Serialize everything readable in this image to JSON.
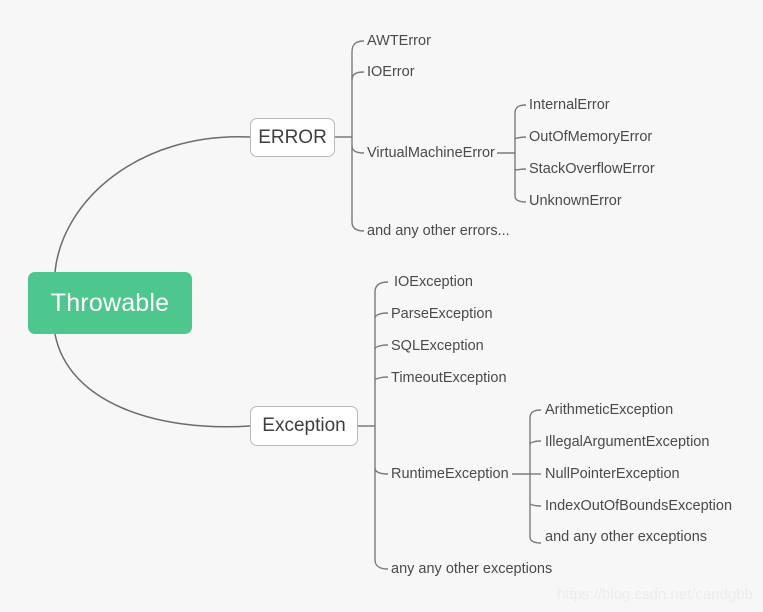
{
  "diagram": {
    "title": "Throwable",
    "background_color": "#f7f7f7",
    "root": {
      "label": "Throwable",
      "fill_color": "#4ec78e",
      "text_color": "#ffffff"
    },
    "branches": [
      {
        "label": "ERROR",
        "children": [
          {
            "label": "AWTError"
          },
          {
            "label": "IOError"
          },
          {
            "label": "VirtualMachineError",
            "children": [
              {
                "label": "InternalError"
              },
              {
                "label": "OutOfMemoryError"
              },
              {
                "label": "StackOverflowError"
              },
              {
                "label": "UnknownError"
              }
            ]
          },
          {
            "label": "and any other errors..."
          }
        ]
      },
      {
        "label": "Exception",
        "children": [
          {
            "label": "IOException"
          },
          {
            "label": "ParseException"
          },
          {
            "label": "SQLException"
          },
          {
            "label": "TimeoutException"
          },
          {
            "label": "RuntimeException",
            "children": [
              {
                "label": "ArithmeticException"
              },
              {
                "label": "IllegalArgumentException"
              },
              {
                "label": "NullPointerException"
              },
              {
                "label": "IndexOutOfBoundsException"
              },
              {
                "label": "and any other exceptions"
              }
            ]
          },
          {
            "label": "any any other exceptions"
          }
        ]
      }
    ],
    "watermark": "https://blog.csdn.net/candgbb"
  }
}
